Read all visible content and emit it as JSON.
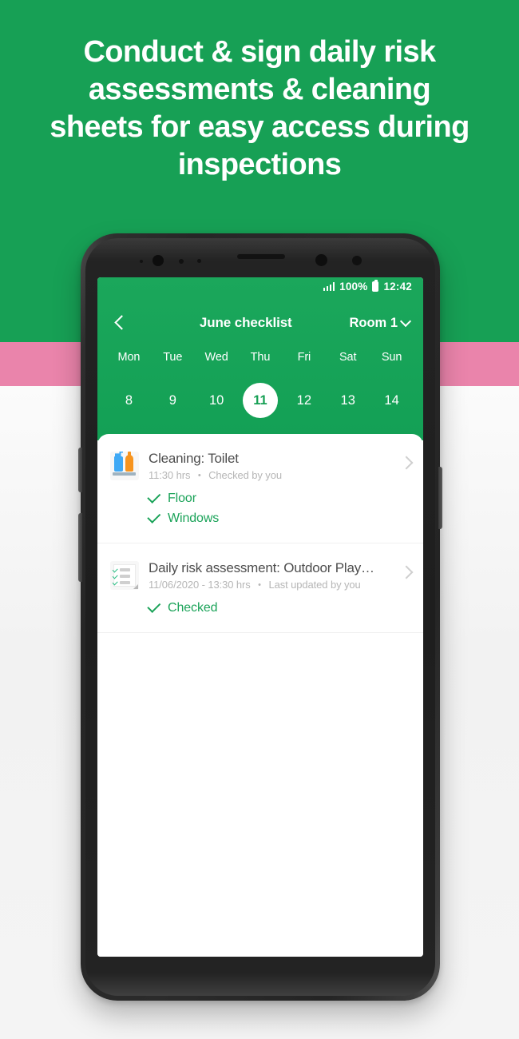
{
  "headline": "Conduct & sign daily risk assessments & cleaning sheets for easy access during inspections",
  "colors": {
    "green": "#17a055",
    "pink": "#ea84ab",
    "white": "#ffffff",
    "check_green": "#1ba359",
    "meta_gray": "#b6b6b6"
  },
  "phone": {
    "status_bar": {
      "signal_icon": "signal-bars-icon",
      "battery_percent": "100%",
      "battery_icon": "battery-full-icon",
      "time": "12:42"
    },
    "nav": {
      "back_icon": "back-chevron-icon",
      "title": "June checklist",
      "room_label": "Room 1",
      "room_chevron_icon": "chevron-down-icon"
    },
    "calendar": {
      "weekdays": [
        "Mon",
        "Tue",
        "Wed",
        "Thu",
        "Fri",
        "Sat",
        "Sun"
      ],
      "dates": [
        "8",
        "9",
        "10",
        "11",
        "12",
        "13",
        "14"
      ],
      "selected_index": 3
    },
    "tasks": [
      {
        "icon": "cleaning-spray-bottles-icon",
        "title": "Cleaning: Toilet",
        "meta_time": "11:30 hrs",
        "meta_separator": "•",
        "meta_status": "Checked by you",
        "chevron_icon": "chevron-right-icon",
        "checks": [
          "Floor",
          "Windows"
        ]
      },
      {
        "icon": "checklist-icon",
        "title": "Daily risk assessment: Outdoor Play…",
        "meta_time": "11/06/2020 - 13:30 hrs",
        "meta_separator": "•",
        "meta_status": "Last updated by you",
        "chevron_icon": "chevron-right-icon",
        "checks": [
          "Checked"
        ]
      }
    ]
  }
}
